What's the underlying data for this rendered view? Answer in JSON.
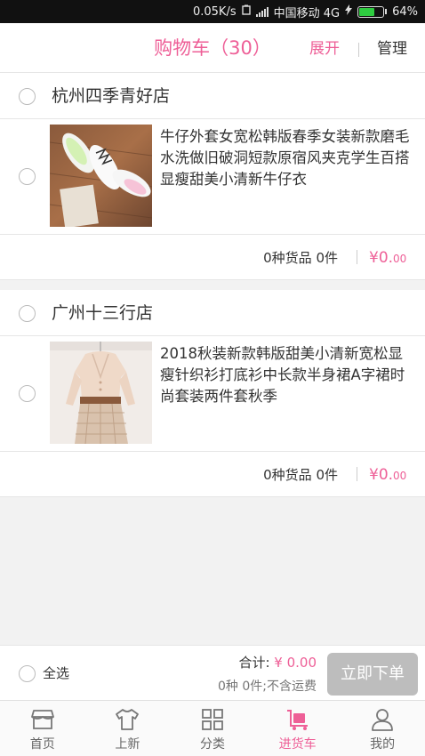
{
  "status_bar": {
    "speed": "0.05K/s",
    "carrier": "中国移动 4G",
    "battery": "64%",
    "battery_level": 0.64
  },
  "header": {
    "title": "购物车（30）",
    "expand_label": "展开",
    "manage_label": "管理"
  },
  "stores": [
    {
      "name": "杭州四季青好店",
      "item_title": "牛仔外套女宽松韩版春季女装新款磨毛水洗做旧破洞短款原宿风夹克学生百搭显瘦甜美小清新牛仔衣",
      "count": "0种货品 0件",
      "price": "¥0.",
      "price_decimal": "00"
    },
    {
      "name": "广州十三行店",
      "item_title": "2018秋装新款韩版甜美小清新宽松显瘦针织衫打底衫中长款半身裙A字裙时尚套装两件套秋季",
      "count": "0种货品 0件",
      "price": "¥0.",
      "price_decimal": "00"
    }
  ],
  "checkout": {
    "select_all": "全选",
    "total_label": "合计:",
    "total_amount": "¥ 0.00",
    "subtotal": "0种 0件;不含运费",
    "submit": "立即下单"
  },
  "tabs": [
    {
      "label": "首页",
      "icon": "store-icon"
    },
    {
      "label": "上新",
      "icon": "tshirt-icon"
    },
    {
      "label": "分类",
      "icon": "grid-icon"
    },
    {
      "label": "进货车",
      "icon": "cart-icon"
    },
    {
      "label": "我的",
      "icon": "user-icon"
    }
  ],
  "colors": {
    "accent": "#ee5f97",
    "disabled_button": "#bdbdbd"
  }
}
